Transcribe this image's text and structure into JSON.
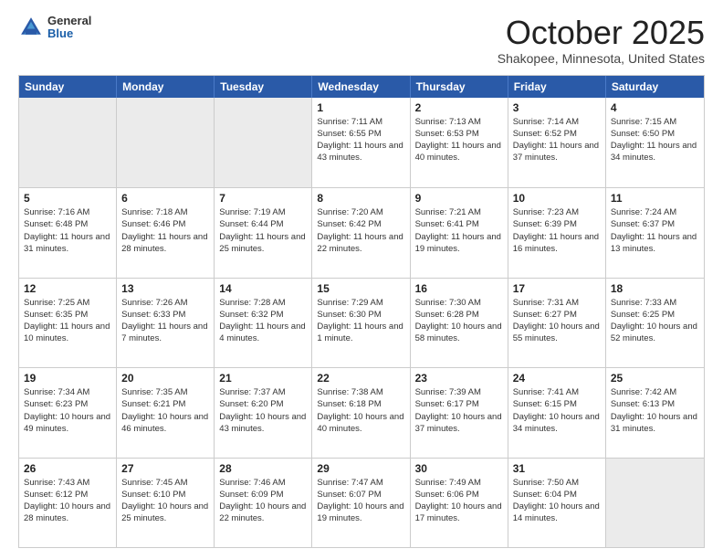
{
  "header": {
    "logo_general": "General",
    "logo_blue": "Blue",
    "month_title": "October 2025",
    "location": "Shakopee, Minnesota, United States"
  },
  "days_of_week": [
    "Sunday",
    "Monday",
    "Tuesday",
    "Wednesday",
    "Thursday",
    "Friday",
    "Saturday"
  ],
  "weeks": [
    [
      {
        "num": "",
        "sunrise": "",
        "sunset": "",
        "daylight": "",
        "empty": true
      },
      {
        "num": "",
        "sunrise": "",
        "sunset": "",
        "daylight": "",
        "empty": true
      },
      {
        "num": "",
        "sunrise": "",
        "sunset": "",
        "daylight": "",
        "empty": true
      },
      {
        "num": "1",
        "sunrise": "Sunrise: 7:11 AM",
        "sunset": "Sunset: 6:55 PM",
        "daylight": "Daylight: 11 hours and 43 minutes."
      },
      {
        "num": "2",
        "sunrise": "Sunrise: 7:13 AM",
        "sunset": "Sunset: 6:53 PM",
        "daylight": "Daylight: 11 hours and 40 minutes."
      },
      {
        "num": "3",
        "sunrise": "Sunrise: 7:14 AM",
        "sunset": "Sunset: 6:52 PM",
        "daylight": "Daylight: 11 hours and 37 minutes."
      },
      {
        "num": "4",
        "sunrise": "Sunrise: 7:15 AM",
        "sunset": "Sunset: 6:50 PM",
        "daylight": "Daylight: 11 hours and 34 minutes."
      }
    ],
    [
      {
        "num": "5",
        "sunrise": "Sunrise: 7:16 AM",
        "sunset": "Sunset: 6:48 PM",
        "daylight": "Daylight: 11 hours and 31 minutes."
      },
      {
        "num": "6",
        "sunrise": "Sunrise: 7:18 AM",
        "sunset": "Sunset: 6:46 PM",
        "daylight": "Daylight: 11 hours and 28 minutes."
      },
      {
        "num": "7",
        "sunrise": "Sunrise: 7:19 AM",
        "sunset": "Sunset: 6:44 PM",
        "daylight": "Daylight: 11 hours and 25 minutes."
      },
      {
        "num": "8",
        "sunrise": "Sunrise: 7:20 AM",
        "sunset": "Sunset: 6:42 PM",
        "daylight": "Daylight: 11 hours and 22 minutes."
      },
      {
        "num": "9",
        "sunrise": "Sunrise: 7:21 AM",
        "sunset": "Sunset: 6:41 PM",
        "daylight": "Daylight: 11 hours and 19 minutes."
      },
      {
        "num": "10",
        "sunrise": "Sunrise: 7:23 AM",
        "sunset": "Sunset: 6:39 PM",
        "daylight": "Daylight: 11 hours and 16 minutes."
      },
      {
        "num": "11",
        "sunrise": "Sunrise: 7:24 AM",
        "sunset": "Sunset: 6:37 PM",
        "daylight": "Daylight: 11 hours and 13 minutes."
      }
    ],
    [
      {
        "num": "12",
        "sunrise": "Sunrise: 7:25 AM",
        "sunset": "Sunset: 6:35 PM",
        "daylight": "Daylight: 11 hours and 10 minutes."
      },
      {
        "num": "13",
        "sunrise": "Sunrise: 7:26 AM",
        "sunset": "Sunset: 6:33 PM",
        "daylight": "Daylight: 11 hours and 7 minutes."
      },
      {
        "num": "14",
        "sunrise": "Sunrise: 7:28 AM",
        "sunset": "Sunset: 6:32 PM",
        "daylight": "Daylight: 11 hours and 4 minutes."
      },
      {
        "num": "15",
        "sunrise": "Sunrise: 7:29 AM",
        "sunset": "Sunset: 6:30 PM",
        "daylight": "Daylight: 11 hours and 1 minute."
      },
      {
        "num": "16",
        "sunrise": "Sunrise: 7:30 AM",
        "sunset": "Sunset: 6:28 PM",
        "daylight": "Daylight: 10 hours and 58 minutes."
      },
      {
        "num": "17",
        "sunrise": "Sunrise: 7:31 AM",
        "sunset": "Sunset: 6:27 PM",
        "daylight": "Daylight: 10 hours and 55 minutes."
      },
      {
        "num": "18",
        "sunrise": "Sunrise: 7:33 AM",
        "sunset": "Sunset: 6:25 PM",
        "daylight": "Daylight: 10 hours and 52 minutes."
      }
    ],
    [
      {
        "num": "19",
        "sunrise": "Sunrise: 7:34 AM",
        "sunset": "Sunset: 6:23 PM",
        "daylight": "Daylight: 10 hours and 49 minutes."
      },
      {
        "num": "20",
        "sunrise": "Sunrise: 7:35 AM",
        "sunset": "Sunset: 6:21 PM",
        "daylight": "Daylight: 10 hours and 46 minutes."
      },
      {
        "num": "21",
        "sunrise": "Sunrise: 7:37 AM",
        "sunset": "Sunset: 6:20 PM",
        "daylight": "Daylight: 10 hours and 43 minutes."
      },
      {
        "num": "22",
        "sunrise": "Sunrise: 7:38 AM",
        "sunset": "Sunset: 6:18 PM",
        "daylight": "Daylight: 10 hours and 40 minutes."
      },
      {
        "num": "23",
        "sunrise": "Sunrise: 7:39 AM",
        "sunset": "Sunset: 6:17 PM",
        "daylight": "Daylight: 10 hours and 37 minutes."
      },
      {
        "num": "24",
        "sunrise": "Sunrise: 7:41 AM",
        "sunset": "Sunset: 6:15 PM",
        "daylight": "Daylight: 10 hours and 34 minutes."
      },
      {
        "num": "25",
        "sunrise": "Sunrise: 7:42 AM",
        "sunset": "Sunset: 6:13 PM",
        "daylight": "Daylight: 10 hours and 31 minutes."
      }
    ],
    [
      {
        "num": "26",
        "sunrise": "Sunrise: 7:43 AM",
        "sunset": "Sunset: 6:12 PM",
        "daylight": "Daylight: 10 hours and 28 minutes."
      },
      {
        "num": "27",
        "sunrise": "Sunrise: 7:45 AM",
        "sunset": "Sunset: 6:10 PM",
        "daylight": "Daylight: 10 hours and 25 minutes."
      },
      {
        "num": "28",
        "sunrise": "Sunrise: 7:46 AM",
        "sunset": "Sunset: 6:09 PM",
        "daylight": "Daylight: 10 hours and 22 minutes."
      },
      {
        "num": "29",
        "sunrise": "Sunrise: 7:47 AM",
        "sunset": "Sunset: 6:07 PM",
        "daylight": "Daylight: 10 hours and 19 minutes."
      },
      {
        "num": "30",
        "sunrise": "Sunrise: 7:49 AM",
        "sunset": "Sunset: 6:06 PM",
        "daylight": "Daylight: 10 hours and 17 minutes."
      },
      {
        "num": "31",
        "sunrise": "Sunrise: 7:50 AM",
        "sunset": "Sunset: 6:04 PM",
        "daylight": "Daylight: 10 hours and 14 minutes."
      },
      {
        "num": "",
        "sunrise": "",
        "sunset": "",
        "daylight": "",
        "empty": true
      }
    ]
  ]
}
